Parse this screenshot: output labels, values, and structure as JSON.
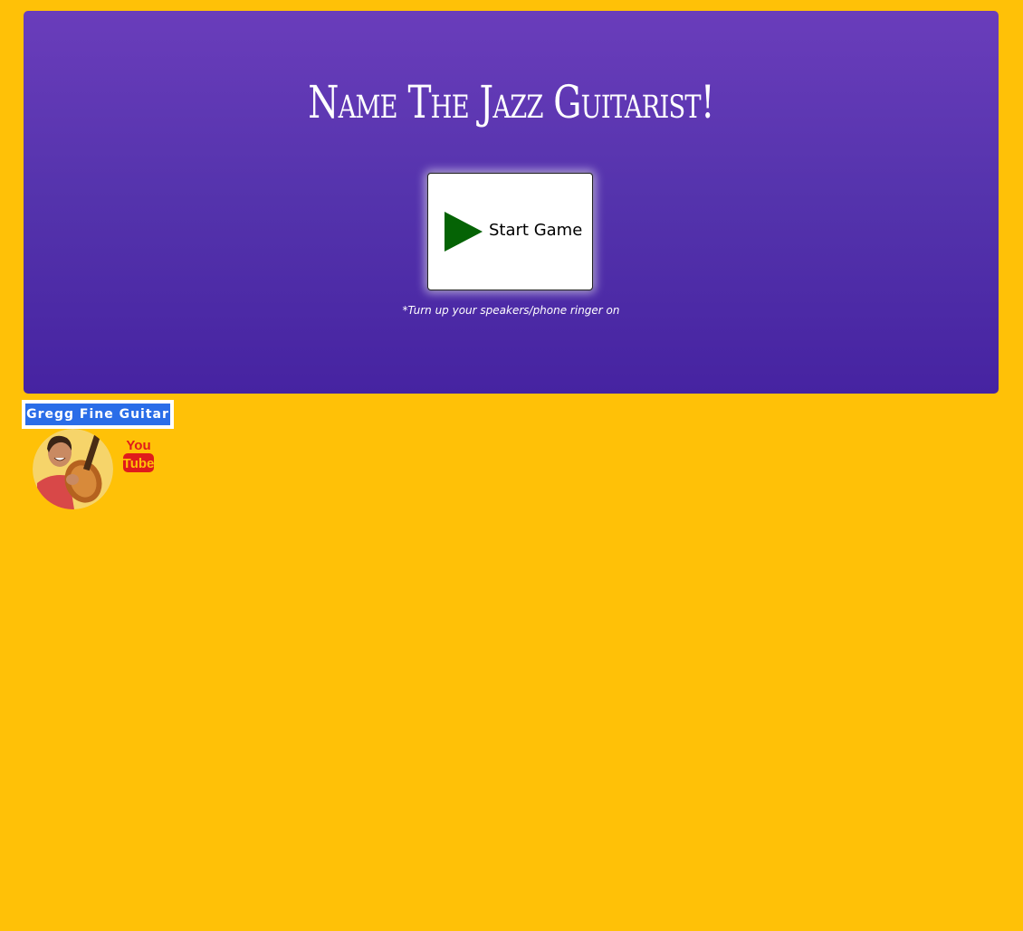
{
  "hero": {
    "title": "Name The Jazz Guitarist!",
    "start_button_label": "Start Game",
    "note": "*Turn up your speakers/phone ringer on"
  },
  "footer": {
    "brand_label": "Gregg Fine Guitar",
    "avatar_icon": "guitarist-avatar-icon",
    "youtube_icon": "youtube-icon",
    "youtube_text_top": "You",
    "youtube_text_bottom": "Tube"
  },
  "colors": {
    "page_background": "#ffc107",
    "hero_gradient_top": "#6a3dbb",
    "hero_gradient_bottom": "#4623a1",
    "play_icon": "#056305",
    "brand_badge": "#2a6de8",
    "youtube_red": "#e01b1b"
  }
}
